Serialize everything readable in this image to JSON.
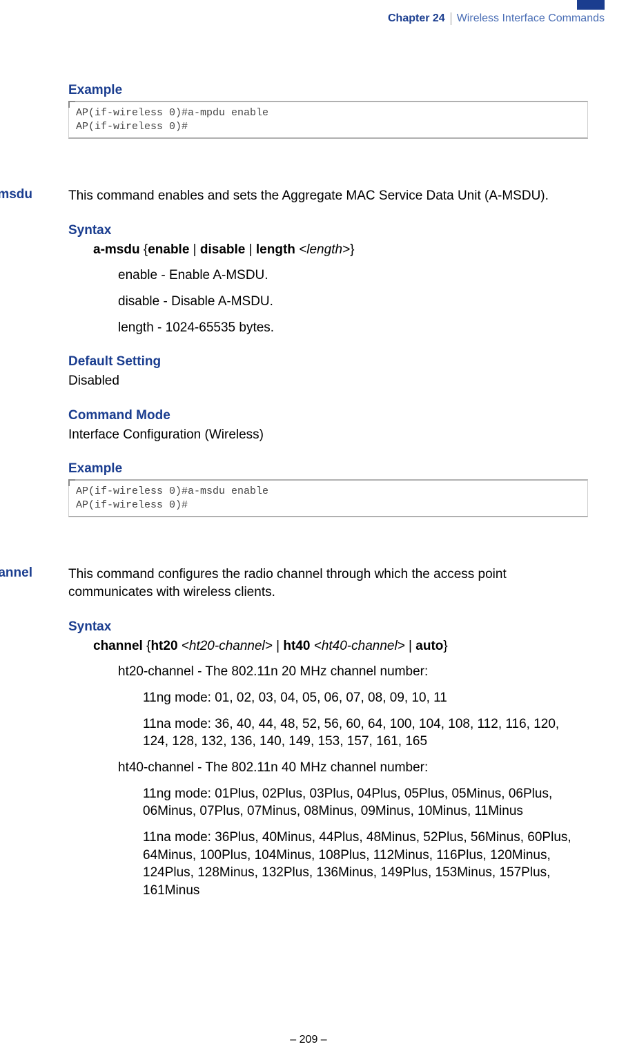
{
  "header": {
    "chapter": "Chapter 24",
    "title": "Wireless Interface Commands"
  },
  "section1": {
    "example_heading": "Example",
    "code": "AP(if-wireless 0)#a-mpdu enable\nAP(if-wireless 0)#"
  },
  "section2": {
    "label": "a-msdu",
    "intro": "This command enables and sets the Aggregate MAC Service Data Unit (A-MSDU).",
    "syntax_heading": "Syntax",
    "syntax_cmd": "a-msdu",
    "syntax_opts_enable": "enable",
    "syntax_opts_disable": "disable",
    "syntax_opts_length": "length",
    "syntax_opts_length_arg": "<length>",
    "param_enable_bold": "enable",
    "param_enable_rest": " - Enable A-MSDU.",
    "param_disable_bold": "disable",
    "param_disable_rest": " - Disable A-MSDU.",
    "param_length_italic": "length",
    "param_length_rest": " - 1024-65535 bytes.",
    "default_heading": "Default Setting",
    "default_value": "Disabled",
    "cmdmode_heading": "Command Mode",
    "cmdmode_value": "Interface Configuration (Wireless)",
    "example_heading": "Example",
    "code": "AP(if-wireless 0)#a-msdu enable\nAP(if-wireless 0)#"
  },
  "section3": {
    "label": "channel",
    "intro": "This command configures the radio channel through which the access point communicates with wireless clients.",
    "syntax_heading": "Syntax",
    "syntax_cmd": "channel",
    "syntax_ht20": "ht20",
    "syntax_ht20_arg": "<ht20-channel>",
    "syntax_ht40": "ht40",
    "syntax_ht40_arg": "<ht40-channel>",
    "syntax_auto": "auto",
    "param_ht20_italic": "ht20-channel",
    "param_ht20_rest": " - The 802.11n 20 MHz channel number:",
    "param_ht20_ng": "11ng mode: 01, 02, 03, 04, 05, 06, 07, 08, 09, 10, 11",
    "param_ht20_na": "11na mode: 36, 40, 44, 48, 52, 56, 60, 64, 100, 104, 108, 112, 116, 120, 124, 128, 132, 136, 140, 149, 153, 157, 161, 165",
    "param_ht40_italic": "ht40-channel",
    "param_ht40_rest": " - The 802.11n 40 MHz channel number:",
    "param_ht40_ng": "11ng mode: 01Plus, 02Plus, 03Plus, 04Plus, 05Plus, 05Minus, 06Plus, 06Minus, 07Plus, 07Minus, 08Minus, 09Minus, 10Minus, 11Minus",
    "param_ht40_na": "11na mode: 36Plus, 40Minus, 44Plus, 48Minus, 52Plus, 56Minus, 60Plus, 64Minus, 100Plus, 104Minus, 108Plus, 112Minus, 116Plus, 120Minus, 124Plus, 128Minus, 132Plus, 136Minus, 149Plus, 153Minus, 157Plus, 161Minus"
  },
  "footer": {
    "page": "–  209  –"
  }
}
